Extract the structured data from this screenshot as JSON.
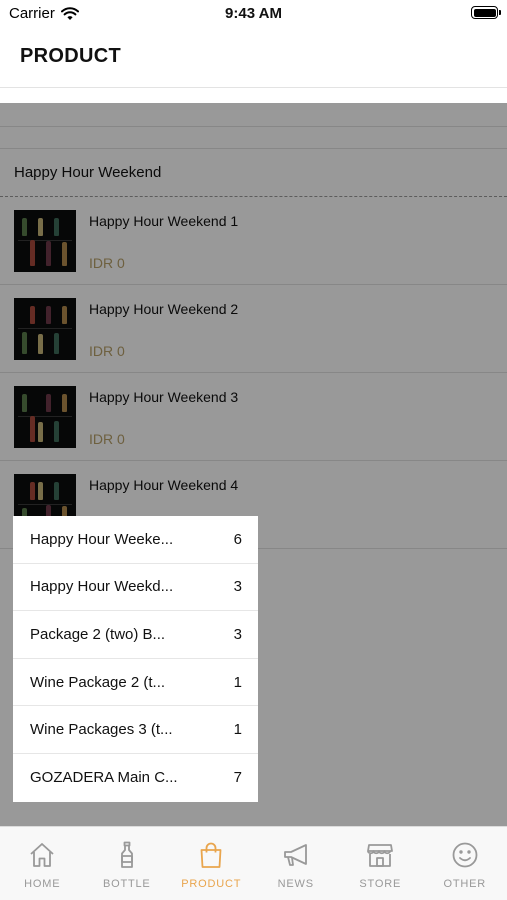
{
  "status_bar": {
    "carrier": "Carrier",
    "time": "9:43 AM"
  },
  "header": {
    "title": "PRODUCT"
  },
  "section": {
    "title": "Happy Hour Weekend",
    "products": [
      {
        "name": "Happy Hour Weekend 1",
        "price": "IDR 0"
      },
      {
        "name": "Happy Hour Weekend 2",
        "price": "IDR 0"
      },
      {
        "name": "Happy Hour Weekend 3",
        "price": "IDR 0"
      },
      {
        "name": "Happy Hour Weekend 4",
        "price": ""
      }
    ]
  },
  "category_popup": {
    "items": [
      {
        "label": "Happy Hour Weeke...",
        "count": "6"
      },
      {
        "label": "Happy Hour Weekd...",
        "count": "3"
      },
      {
        "label": "Package 2 (two) B...",
        "count": "3"
      },
      {
        "label": "Wine Package 2 (t...",
        "count": "1"
      },
      {
        "label": "Wine Packages 3 (t...",
        "count": "1"
      },
      {
        "label": "GOZADERA Main C...",
        "count": "7"
      }
    ]
  },
  "tabbar": {
    "tabs": [
      {
        "label": "HOME",
        "icon": "home-icon"
      },
      {
        "label": "BOTTLE",
        "icon": "bottle-icon"
      },
      {
        "label": "PRODUCT",
        "icon": "shopping-bag-icon",
        "active": true
      },
      {
        "label": "NEWS",
        "icon": "megaphone-icon"
      },
      {
        "label": "STORE",
        "icon": "store-icon"
      },
      {
        "label": "OTHER",
        "icon": "smiley-icon"
      }
    ],
    "active_color": "#e9a54d",
    "inactive_color": "#999999"
  },
  "colors": {
    "price": "#b7a16a",
    "accent": "#e9a54d"
  }
}
